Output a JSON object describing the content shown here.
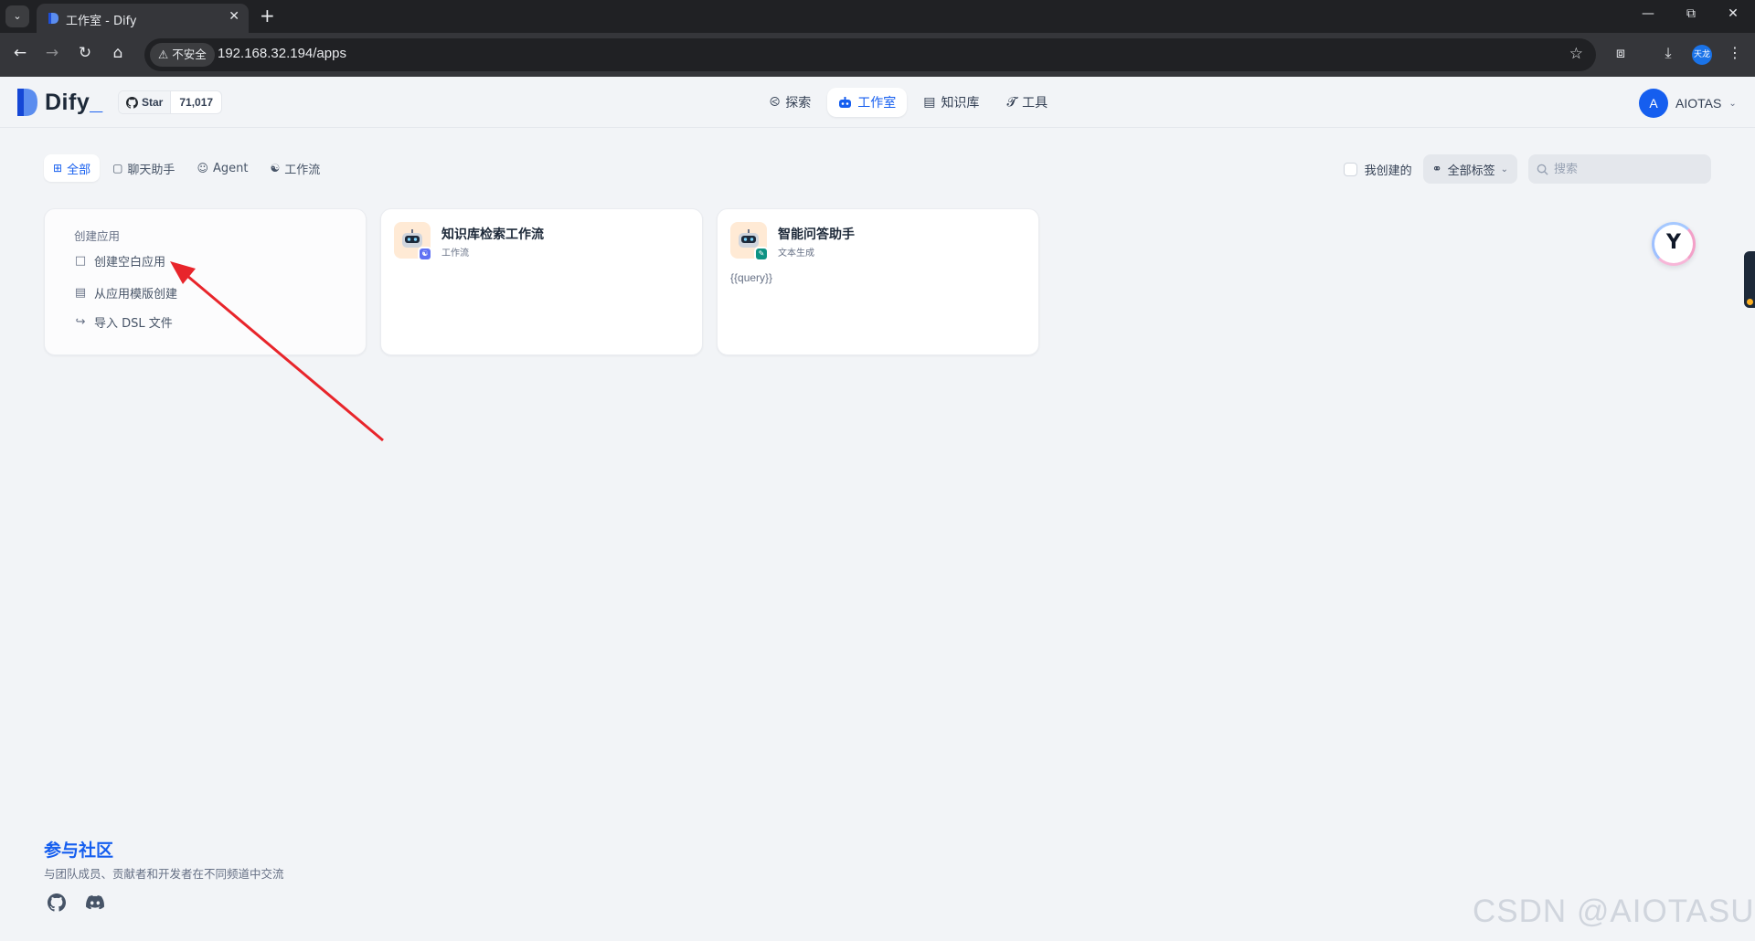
{
  "browser": {
    "tab_title": "工作室 - Dify",
    "insecure_label": "不安全",
    "url": "192.168.32.194/apps",
    "profile_label": "天龙"
  },
  "header": {
    "logo_text": "Dify",
    "logo_suffix": "_",
    "github_star_label": "Star",
    "github_star_count": "71,017",
    "nav": [
      {
        "label": "探索",
        "icon": "compass-icon"
      },
      {
        "label": "工作室",
        "icon": "robot-icon",
        "active": true
      },
      {
        "label": "知识库",
        "icon": "book-icon"
      },
      {
        "label": "工具",
        "icon": "hammer-icon"
      }
    ],
    "account": {
      "avatar_initial": "A",
      "name": "AIOTAS"
    }
  },
  "filters": {
    "tabs": [
      {
        "label": "全部",
        "icon": "grid-icon",
        "active": true
      },
      {
        "label": "聊天助手",
        "icon": "chat-icon"
      },
      {
        "label": "Agent",
        "icon": "agent-icon"
      },
      {
        "label": "工作流",
        "icon": "workflow-icon"
      }
    ],
    "mine_label": "我创建的",
    "mine_checked": false,
    "tags_label": "全部标签",
    "search_placeholder": "搜索"
  },
  "create_card": {
    "title": "创建应用",
    "items": [
      {
        "label": "创建空白应用",
        "icon": "blank-file-icon"
      },
      {
        "label": "从应用模版创建",
        "icon": "template-icon"
      },
      {
        "label": "导入 DSL 文件",
        "icon": "import-icon"
      }
    ]
  },
  "apps": [
    {
      "name": "知识库检索工作流",
      "type": "工作流",
      "description": "",
      "badge_color": "#6172f3"
    },
    {
      "name": "智能问答助手",
      "type": "文本生成",
      "description": "{{query}}",
      "badge_color": "#0e9384"
    }
  ],
  "community": {
    "title": "参与社区",
    "subtitle": "与团队成员、贡献者和开发者在不同频道中交流",
    "links": [
      "github-icon",
      "discord-icon"
    ]
  },
  "watermark": "CSDN @AIOTASUD",
  "colors": {
    "accent": "#155eef",
    "annotation_arrow": "#e8252b",
    "background": "#f2f4f7"
  }
}
